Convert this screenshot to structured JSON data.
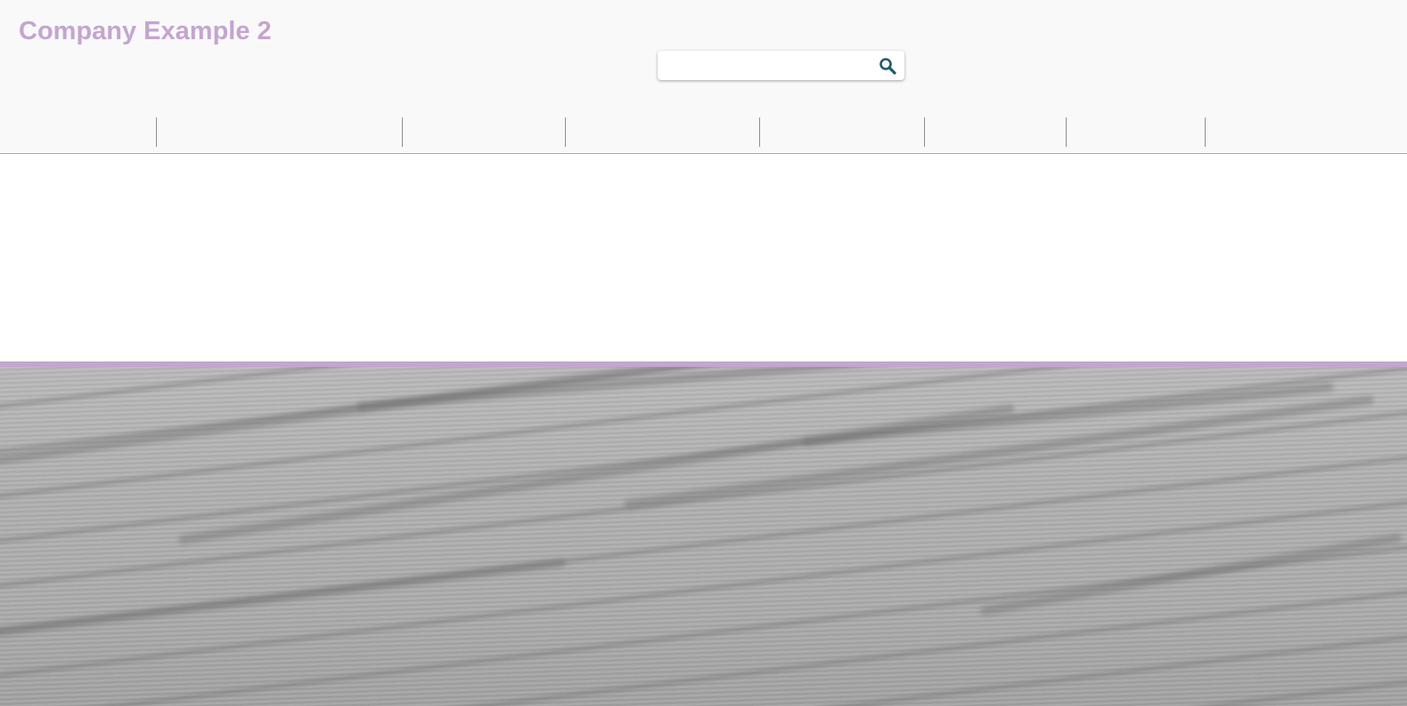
{
  "header": {
    "brand": "Company Example 2",
    "brand_color": "#c4a5d0",
    "background_color": "#f9f9f9"
  },
  "search": {
    "value": "",
    "placeholder": "",
    "icon": "search-icon",
    "icon_color": "#1f5a6a"
  },
  "nav": {
    "items": [
      {
        "label": ""
      },
      {
        "label": ""
      },
      {
        "label": ""
      },
      {
        "label": ""
      },
      {
        "label": ""
      },
      {
        "label": ""
      },
      {
        "label": ""
      },
      {
        "label": ""
      }
    ]
  },
  "theme": {
    "accent_color": "#c4a5d0",
    "hero_color": "#adadad"
  }
}
